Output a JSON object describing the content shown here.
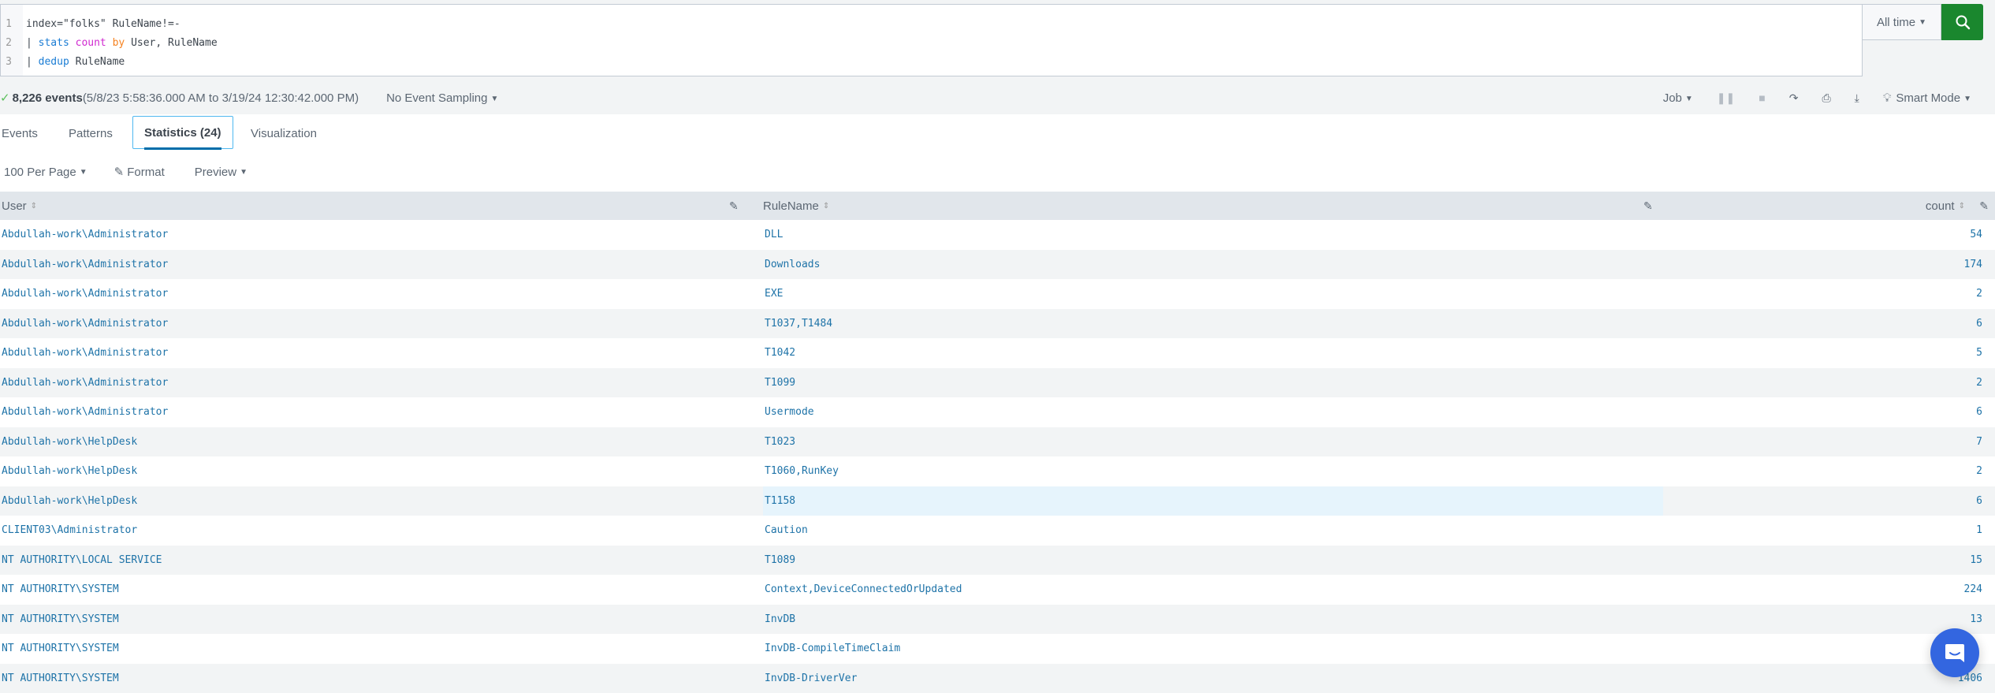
{
  "search": {
    "lines": [
      {
        "num": "1",
        "parts": [
          {
            "t": "index=\"folks\" RuleName!=-",
            "c": ""
          }
        ]
      },
      {
        "num": "2",
        "parts": [
          {
            "t": "| ",
            "c": ""
          },
          {
            "t": "stats",
            "c": "kw-cmd"
          },
          {
            "t": " ",
            "c": ""
          },
          {
            "t": "count",
            "c": "kw-fn"
          },
          {
            "t": " ",
            "c": ""
          },
          {
            "t": "by",
            "c": "kw-by"
          },
          {
            "t": " User, RuleName",
            "c": ""
          }
        ]
      },
      {
        "num": "3",
        "parts": [
          {
            "t": "| ",
            "c": ""
          },
          {
            "t": "dedup",
            "c": "kw-cmd"
          },
          {
            "t": " RuleName",
            "c": ""
          }
        ]
      }
    ],
    "time_range": "All time",
    "search_icon": "search-icon"
  },
  "status": {
    "check_icon": "✓",
    "events_count": "8,226 events",
    "range": " (5/8/23 5:58:36.000 AM to 3/19/24 12:30:42.000 PM)",
    "sampling": "No Event Sampling",
    "job": "Job",
    "mode": "Smart Mode"
  },
  "tabs": [
    {
      "label": "Events"
    },
    {
      "label": "Patterns"
    },
    {
      "label": "Statistics (24)",
      "active": true
    },
    {
      "label": "Visualization"
    }
  ],
  "toolbar": {
    "per_page": "100 Per Page",
    "format": "Format",
    "preview": "Preview"
  },
  "table": {
    "columns": [
      "User",
      "RuleName",
      "count"
    ],
    "rows": [
      {
        "user": "Abdullah-work\\Administrator",
        "rule": "DLL",
        "count": "54"
      },
      {
        "user": "Abdullah-work\\Administrator",
        "rule": "Downloads",
        "count": "174"
      },
      {
        "user": "Abdullah-work\\Administrator",
        "rule": "EXE",
        "count": "2"
      },
      {
        "user": "Abdullah-work\\Administrator",
        "rule": "T1037,T1484",
        "count": "6"
      },
      {
        "user": "Abdullah-work\\Administrator",
        "rule": "T1042",
        "count": "5"
      },
      {
        "user": "Abdullah-work\\Administrator",
        "rule": "T1099",
        "count": "2"
      },
      {
        "user": "Abdullah-work\\Administrator",
        "rule": "Usermode",
        "count": "6"
      },
      {
        "user": "Abdullah-work\\HelpDesk",
        "rule": "T1023",
        "count": "7"
      },
      {
        "user": "Abdullah-work\\HelpDesk",
        "rule": "T1060,RunKey",
        "count": "2"
      },
      {
        "user": "Abdullah-work\\HelpDesk",
        "rule": "T1158",
        "count": "6",
        "highlight": true
      },
      {
        "user": "CLIENT03\\Administrator",
        "rule": "Caution",
        "count": "1"
      },
      {
        "user": "NT AUTHORITY\\LOCAL SERVICE",
        "rule": "T1089",
        "count": "15"
      },
      {
        "user": "NT AUTHORITY\\SYSTEM",
        "rule": "Context,DeviceConnectedOrUpdated",
        "count": "224"
      },
      {
        "user": "NT AUTHORITY\\SYSTEM",
        "rule": "InvDB",
        "count": "13"
      },
      {
        "user": "NT AUTHORITY\\SYSTEM",
        "rule": "InvDB-CompileTimeClaim",
        "count": ""
      },
      {
        "user": "NT AUTHORITY\\SYSTEM",
        "rule": "InvDB-DriverVer",
        "count": "1406"
      }
    ]
  },
  "chat": {
    "icon": "chat-icon"
  }
}
